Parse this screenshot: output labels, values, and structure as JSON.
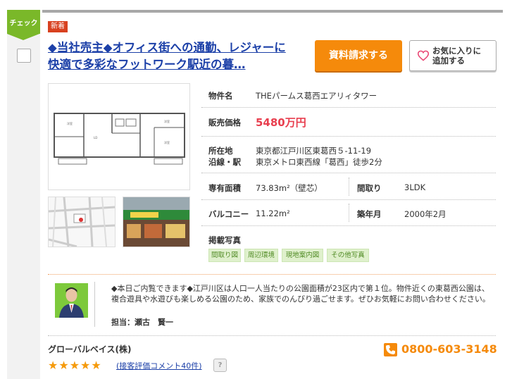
{
  "sidebar": {
    "check_label": "チェック"
  },
  "listing": {
    "badge": "新着",
    "title": "◆当社売主◆オフィス街への通勤、レジャーに快適で多彩なフットワーク駅近の暮…"
  },
  "buttons": {
    "request_label": "資料請求する",
    "favorite_label_line1": "お気に入りに",
    "favorite_label_line2": "追加する"
  },
  "property": {
    "name_label": "物件名",
    "name_value": "THEパームス葛西エアリィタワー",
    "price_label": "販売価格",
    "price_value": "5480万円",
    "address_label": "所在地",
    "address_value": "東京都江戸川区東葛西５-11-19",
    "line_label": "沿線・駅",
    "line_value": "東京メトロ東西線「葛西」徒歩2分",
    "area_label": "専有面積",
    "area_value": "73.83m²（壁芯）",
    "layout_label": "間取り",
    "layout_value": "3LDK",
    "balcony_label": "バルコニー",
    "balcony_value": "11.22m²",
    "built_label": "築年月",
    "built_value": "2000年2月",
    "photos_label": "掲載写真",
    "photo_tags": [
      "間取り図",
      "周辺環境",
      "現地案内図",
      "その他写真"
    ]
  },
  "comment": {
    "text": "◆本日ご内覧できます◆江戸川区は人口一人当たりの公園面積が23区内で第１位。物件近くの東葛西公園は、複合遊具や水遊びも楽しめる公園のため、家族でのんびり過ごせます。ぜひお気軽にお問い合わせください。",
    "agent": "担当：瀬古　賢一"
  },
  "company": {
    "name": "グローバルベイス(株)",
    "phone": "0800-603-3148",
    "rating_stars": 5,
    "stars_display": "★★★★★",
    "review_link": "(接客評価コメント40件)",
    "help_label": "?"
  },
  "colors": {
    "accent_orange": "#f58a0b",
    "check_green": "#7ab829",
    "link_blue": "#1c40a8",
    "price_red": "#e83e4e",
    "badge_red": "#d8411f"
  }
}
